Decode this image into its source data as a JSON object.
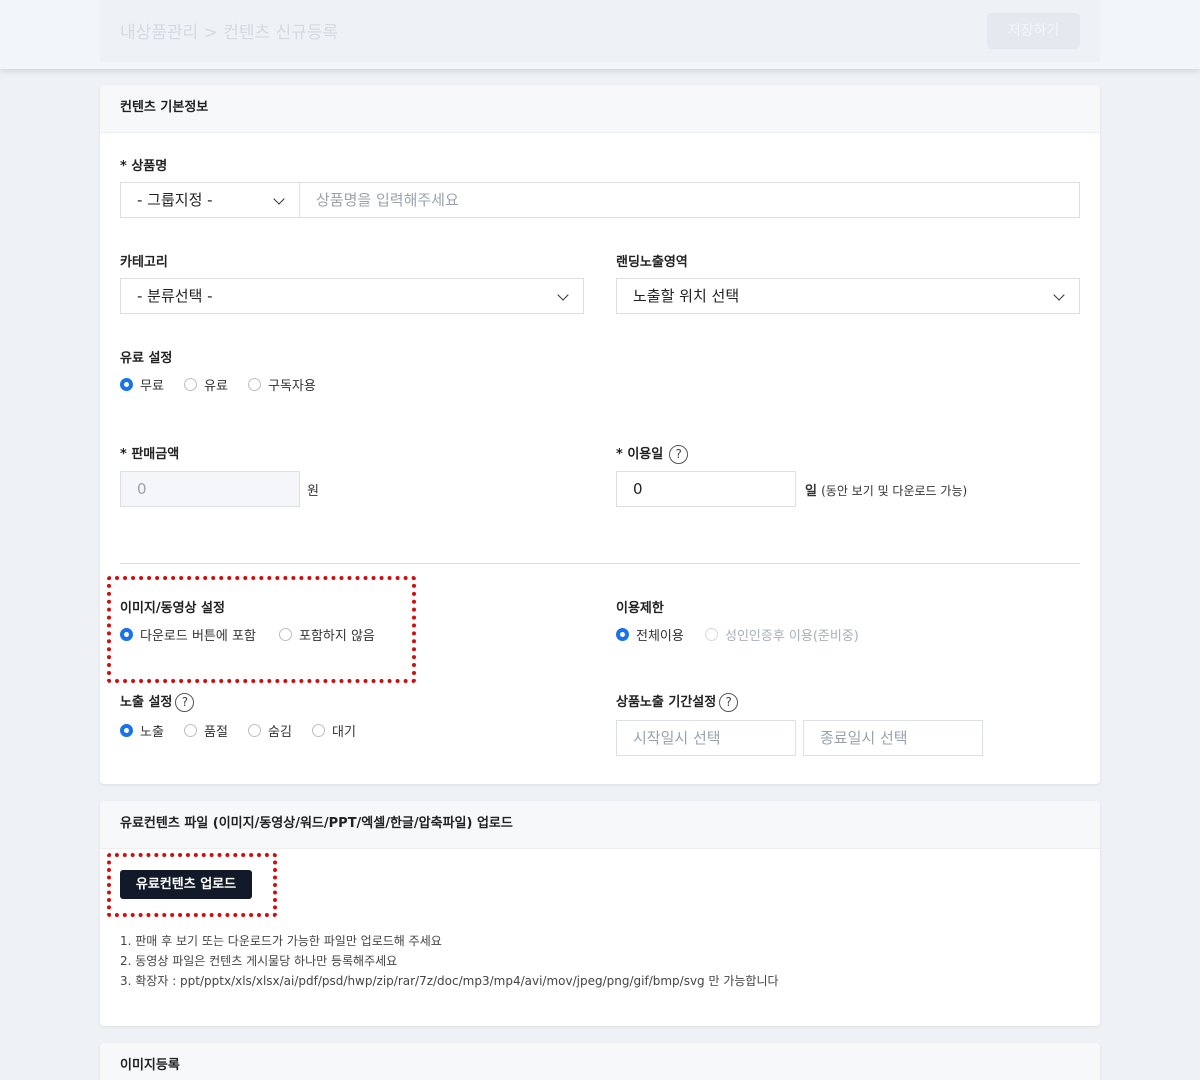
{
  "header": {
    "breadcrumb": "내상품관리 > 컨텐츠 신규등록",
    "save_label": "저장하기"
  },
  "basic_info": {
    "title": "컨텐츠 기본정보",
    "product_name": {
      "label": "* 상품명",
      "group_select": "- 그룹지정 -",
      "placeholder": "상품명을 입력해주세요"
    },
    "category": {
      "label": "카테고리",
      "select": "- 분류선택 -"
    },
    "landing": {
      "label": "랜딩노출영역",
      "select": "노출할 위치 선택"
    },
    "pay_setting": {
      "label": "유료 설정",
      "options": [
        "무료",
        "유료",
        "구독자용"
      ],
      "selected": 0
    },
    "price": {
      "label": "* 판매금액",
      "value": "0",
      "unit": "원"
    },
    "usage_days": {
      "label": "* 이용일",
      "help": "?",
      "value": "0",
      "unit": "일",
      "suffix": "(동안 보기 및 다운로드 가능)"
    },
    "media_setting": {
      "label": "이미지/동영상 설정",
      "options": [
        "다운로드 버튼에 포함",
        "포함하지 않음"
      ],
      "selected": 0
    },
    "restriction": {
      "label": "이용제한",
      "options": [
        "전체이용",
        "성인인증후 이용(준비중)"
      ],
      "selected": 0
    },
    "exposure": {
      "label": "노출 설정",
      "help": "?",
      "options": [
        "노출",
        "품절",
        "숨김",
        "대기"
      ],
      "selected": 0
    },
    "period": {
      "label": "상품노출 기간설정",
      "help": "?",
      "start_placeholder": "시작일시 선택",
      "end_placeholder": "종료일시 선택"
    }
  },
  "upload": {
    "title": "유료컨텐츠 파일 (이미지/동영상/워드/PPT/엑셀/한글/압축파일) 업로드",
    "button": "유료컨텐츠 업로드",
    "notes": [
      "1. 판매 후 보기 또는 다운로드가 가능한 파일만 업로드해 주세요",
      "2. 동영상 파일은 컨텐츠 게시물당 하나만 등록해주세요",
      "3. 확장자 : ppt/pptx/xls/xlsx/ai/pdf/psd/hwp/zip/rar/7z/doc/mp3/mp4/avi/mov/jpeg/png/gif/bmp/svg 만 가능합니다"
    ]
  },
  "image_reg": {
    "title": "이미지등록"
  },
  "colors": {
    "accent": "#1a73e8",
    "highlight": "#d10d0d",
    "dark_button": "#121a29"
  }
}
